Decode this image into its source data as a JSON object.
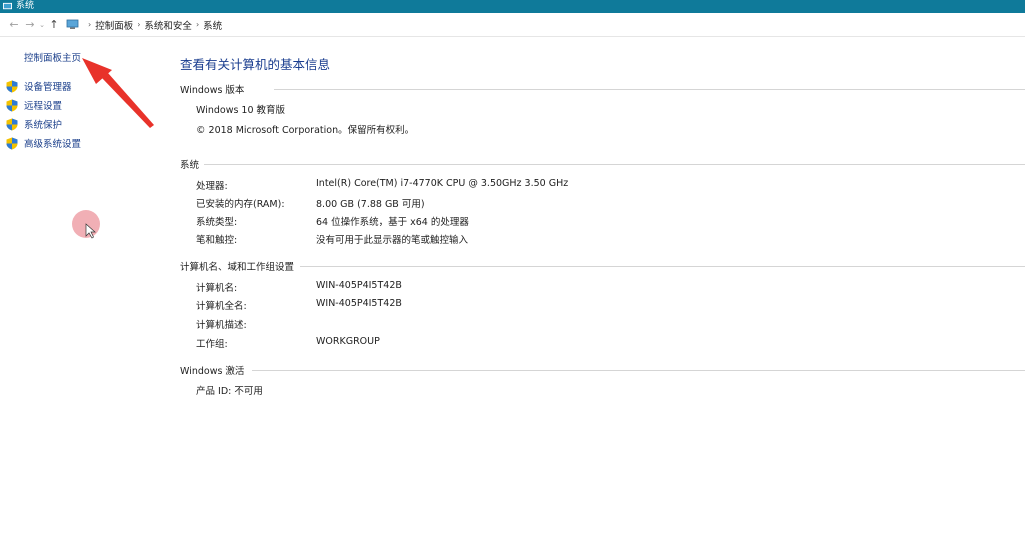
{
  "window": {
    "title": "系统"
  },
  "address": {
    "crumbs": [
      "控制面板",
      "系统和安全",
      "系统"
    ]
  },
  "left": {
    "home": "控制面板主页",
    "tasks": [
      "设备管理器",
      "远程设置",
      "系统保护",
      "高级系统设置"
    ]
  },
  "main": {
    "heading": "查看有关计算机的基本信息",
    "edition": {
      "title": "Windows 版本",
      "name": "Windows 10 教育版",
      "copyright": "© 2018 Microsoft Corporation。保留所有权利。"
    },
    "system": {
      "title": "系统",
      "rows": [
        {
          "label": "处理器:",
          "value": "Intel(R) Core(TM) i7-4770K CPU @ 3.50GHz   3.50 GHz"
        },
        {
          "label": "已安装的内存(RAM):",
          "value": "8.00 GB (7.88 GB 可用)"
        },
        {
          "label": "系统类型:",
          "value": "64 位操作系统，基于 x64 的处理器"
        },
        {
          "label": "笔和触控:",
          "value": "没有可用于此显示器的笔或触控输入"
        }
      ]
    },
    "computer": {
      "title": "计算机名、域和工作组设置",
      "rows": [
        {
          "label": "计算机名:",
          "value": "WIN-405P4I5T42B"
        },
        {
          "label": "计算机全名:",
          "value": "WIN-405P4I5T42B"
        },
        {
          "label": "计算机描述:",
          "value": ""
        },
        {
          "label": "工作组:",
          "value": "WORKGROUP"
        }
      ]
    },
    "activation": {
      "title": "Windows 激活",
      "status": "产品 ID: 不可用"
    }
  },
  "colors": {
    "titlebar": "#0f7a9a",
    "link": "#1b3f8b",
    "heading": "#1a3d8f",
    "annotation": "#e8322a"
  },
  "icons": [
    "window-icon",
    "back-arrow-icon",
    "forward-arrow-icon",
    "up-arrow-icon",
    "computer-icon",
    "shield-icon"
  ]
}
